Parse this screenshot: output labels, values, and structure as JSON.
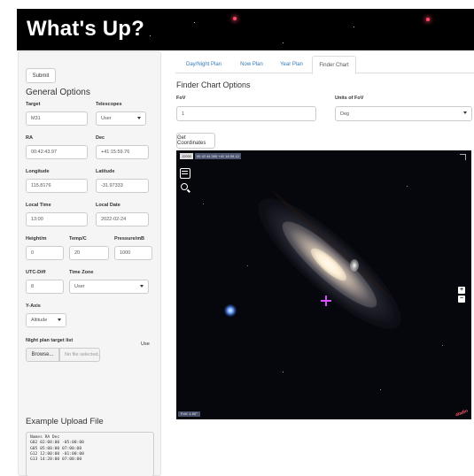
{
  "app": {
    "title": "What's Up?"
  },
  "sidebar": {
    "submit_label": "Submit",
    "general_options_heading": "General Options",
    "target": {
      "label": "Target",
      "value": "M31"
    },
    "telescopes": {
      "label": "Telescopes",
      "value": "User"
    },
    "ra": {
      "label": "RA",
      "value": "00:42:43.97"
    },
    "dec": {
      "label": "Dec",
      "value": "+41:15:59.76"
    },
    "longitude": {
      "label": "Longitude",
      "value": "115.8176"
    },
    "latitude": {
      "label": "Latitude",
      "value": "-31.97333"
    },
    "local_time": {
      "label": "Local Time",
      "value": "13:00"
    },
    "local_date": {
      "label": "Local Date",
      "value": "2022-02-24"
    },
    "height": {
      "label": "Height/m",
      "value": "0"
    },
    "temp": {
      "label": "Temp/C",
      "value": "20"
    },
    "pressure": {
      "label": "Pressure/mB",
      "value": "1000"
    },
    "utc_diff": {
      "label": "UTC-Diff",
      "value": "8"
    },
    "time_zone": {
      "label": "Time Zone",
      "value": "User"
    },
    "y_axis": {
      "label": "Y-Axis",
      "value": "Altitude"
    },
    "night_plan_file": {
      "label": "Night plan target list",
      "use_label": "Use",
      "browse_label": "Browse...",
      "placeholder": "No file selected."
    },
    "example_upload_heading": "Example Upload File",
    "example_upload_lines": "Names RA Dec\nG02 02:08:00 -05:00:00\nG05 05:00:00 07:00:00\nG12 12:00:00 -01:00:00\nG13 14:20:00 07:00:00"
  },
  "tabs": [
    {
      "label": "Day/Night Plan",
      "active": false
    },
    {
      "label": "Now Plan",
      "active": false
    },
    {
      "label": "Year Plan",
      "active": false
    },
    {
      "label": "Finder Chart",
      "active": true
    }
  ],
  "finder": {
    "heading": "Finder Chart Options",
    "fov": {
      "label": "FoV",
      "value": "1"
    },
    "units": {
      "label": "Units of FoV",
      "value": "Deg"
    },
    "get_coords_label": "Get Coordinates"
  },
  "sky_view": {
    "survey_label": "J2000",
    "coord_readout": "00 42 44.300 +41 16 09.12",
    "fov_readout": "FoV: 1.00°",
    "logo_text": "aladin",
    "zoom_in": "+",
    "zoom_out": "−",
    "colors": {
      "reticle": "#d84cff",
      "background": "#06070c"
    }
  }
}
